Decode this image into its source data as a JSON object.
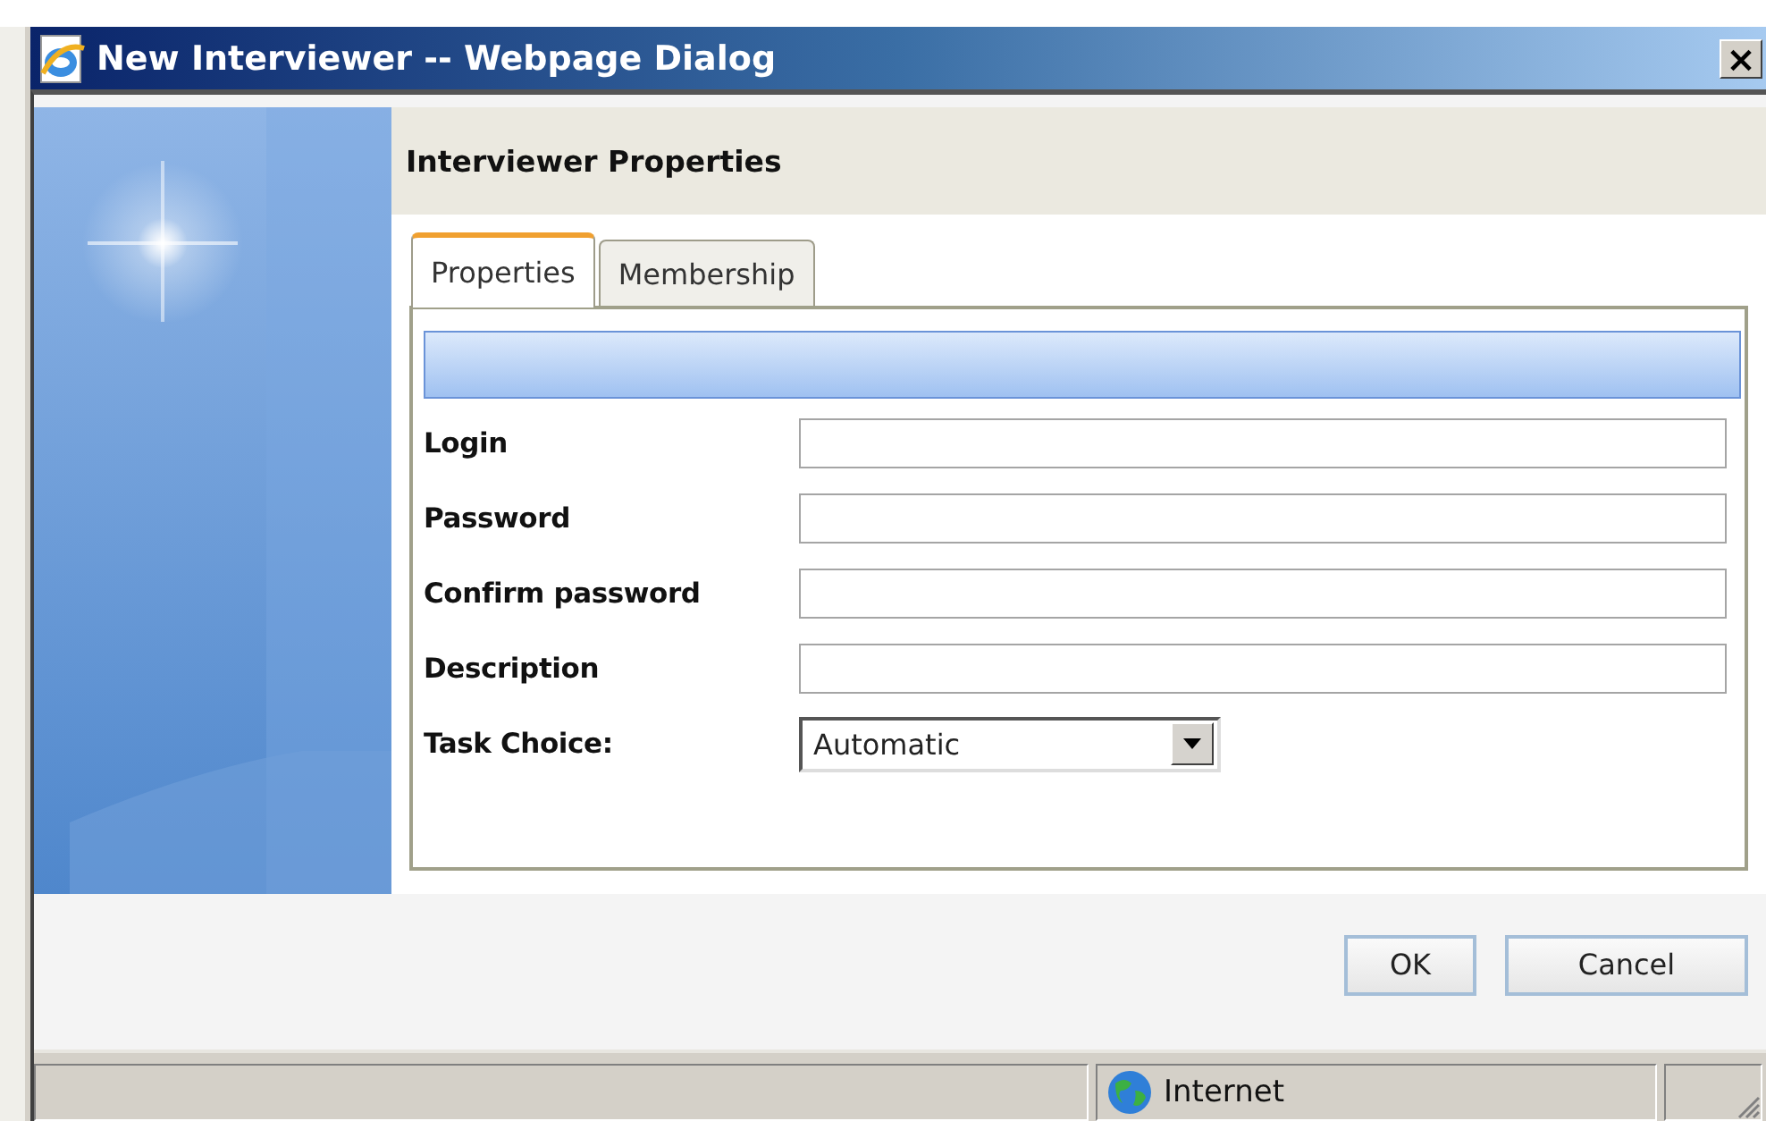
{
  "window": {
    "title": "New Interviewer -- Webpage Dialog",
    "close": "×"
  },
  "header": {
    "title": "Interviewer Properties"
  },
  "tabs": [
    {
      "label": "Properties",
      "selected": true
    },
    {
      "label": "Membership",
      "selected": false
    }
  ],
  "fields": [
    {
      "label": "Login",
      "kind": "text"
    },
    {
      "label": "Password",
      "kind": "text"
    },
    {
      "label": "Confirm password",
      "kind": "text"
    },
    {
      "label": "Description",
      "kind": "text"
    },
    {
      "label": "Task Choice:",
      "kind": "select",
      "value": "Automatic"
    }
  ],
  "buttons": [
    "OK",
    "Cancel"
  ],
  "status_bar": {
    "zone": "Internet"
  }
}
